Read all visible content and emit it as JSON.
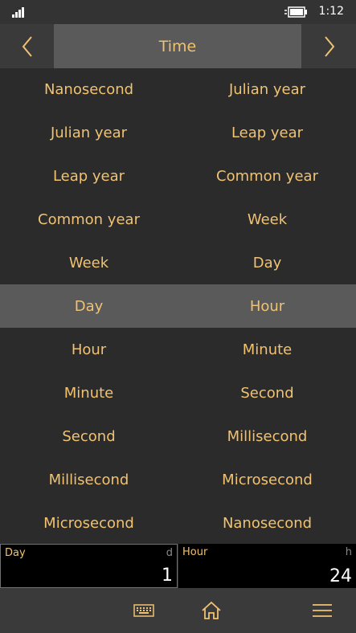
{
  "status": {
    "time": "1:12"
  },
  "header": {
    "title": "Time"
  },
  "picker": {
    "rows": [
      {
        "from": "Nanosecond",
        "to": "Julian year"
      },
      {
        "from": "Julian year",
        "to": "Leap year"
      },
      {
        "from": "Leap year",
        "to": "Common year"
      },
      {
        "from": "Common year",
        "to": "Week"
      },
      {
        "from": "Week",
        "to": "Day"
      },
      {
        "from": "Day",
        "to": "Hour"
      },
      {
        "from": "Hour",
        "to": "Minute"
      },
      {
        "from": "Minute",
        "to": "Second"
      },
      {
        "from": "Second",
        "to": "Millisecond"
      },
      {
        "from": "Millisecond",
        "to": "Microsecond"
      },
      {
        "from": "Microsecond",
        "to": "Nanosecond"
      }
    ],
    "selected_index": 5
  },
  "values": {
    "from": {
      "label": "Day",
      "unit": "d",
      "value": "1"
    },
    "to": {
      "label": "Hour",
      "unit": "h",
      "value": "24"
    }
  },
  "colors": {
    "accent": "#f0c272",
    "background": "#2b2b2b",
    "selected": "#5a5a5a",
    "bar": "#3a3a3a"
  },
  "icons": {
    "prev": "chevron-left-icon",
    "next": "chevron-right-icon",
    "keyboard": "keyboard-icon",
    "home": "home-icon",
    "menu": "hamburger-menu-icon"
  }
}
